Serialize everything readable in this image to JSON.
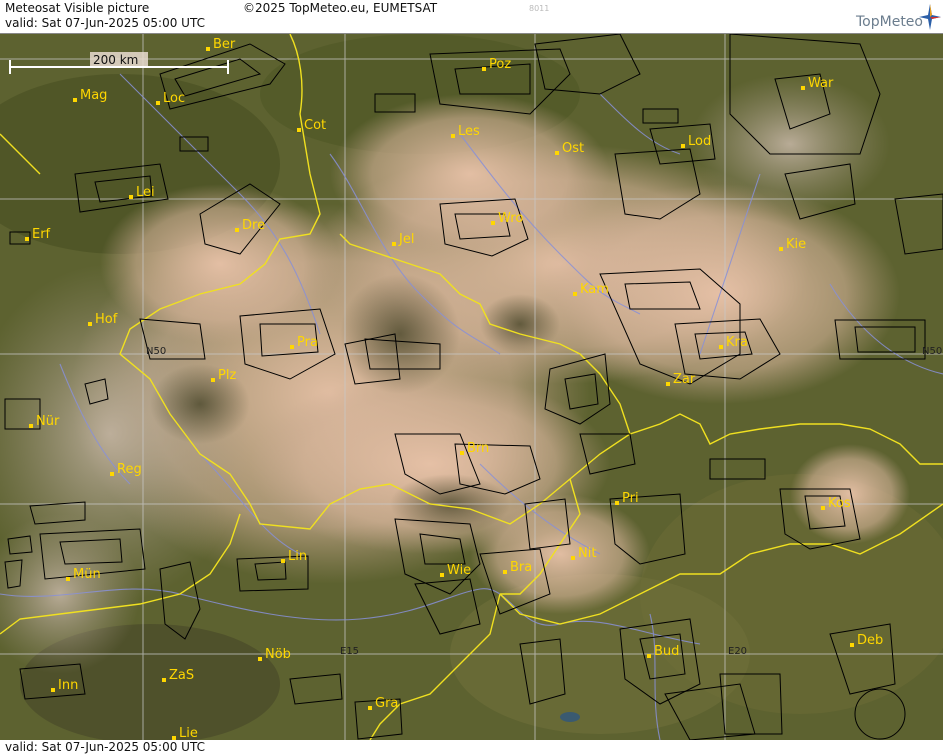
{
  "header": {
    "title": "Meteosat Visible picture",
    "valid": "valid:  Sat  07-Jun-2025  05:00 UTC",
    "copyright": "©2025 TopMeteo.eu, EUMETSAT",
    "code": "8011",
    "logo": "TopMeteo"
  },
  "footer": {
    "valid": "valid:  Sat  07-Jun-2025  05:00 UTC"
  },
  "scale": {
    "label": "200 km"
  },
  "grid_labels": [
    "N50",
    "N50",
    "E15",
    "E20"
  ],
  "cities": [
    {
      "name": "Ber"
    },
    {
      "name": "Poz"
    },
    {
      "name": "War"
    },
    {
      "name": "Mag"
    },
    {
      "name": "Loc"
    },
    {
      "name": "Cot"
    },
    {
      "name": "Les"
    },
    {
      "name": "Lod"
    },
    {
      "name": "Ost"
    },
    {
      "name": "Lei"
    },
    {
      "name": "Wro"
    },
    {
      "name": "Erf"
    },
    {
      "name": "Dre"
    },
    {
      "name": "Jel"
    },
    {
      "name": "Kie"
    },
    {
      "name": "Kam"
    },
    {
      "name": "Hof"
    },
    {
      "name": "Pra"
    },
    {
      "name": "Kra"
    },
    {
      "name": "Plz"
    },
    {
      "name": "Zar"
    },
    {
      "name": "Nür"
    },
    {
      "name": "Brn"
    },
    {
      "name": "Reg"
    },
    {
      "name": "Pri"
    },
    {
      "name": "Kos"
    },
    {
      "name": "Nit"
    },
    {
      "name": "Lin"
    },
    {
      "name": "Mün"
    },
    {
      "name": "Wie"
    },
    {
      "name": "Bra"
    },
    {
      "name": "Inn"
    },
    {
      "name": "ZaS"
    },
    {
      "name": "Nöb"
    },
    {
      "name": "Bud"
    },
    {
      "name": "Deb"
    },
    {
      "name": "Gra"
    },
    {
      "name": "Lie"
    }
  ],
  "colors": {
    "city": "#ffd700",
    "border": "#f0e020",
    "rivers": "#8890d8",
    "grid": "#c8c8c8",
    "airspace": "#000000"
  }
}
